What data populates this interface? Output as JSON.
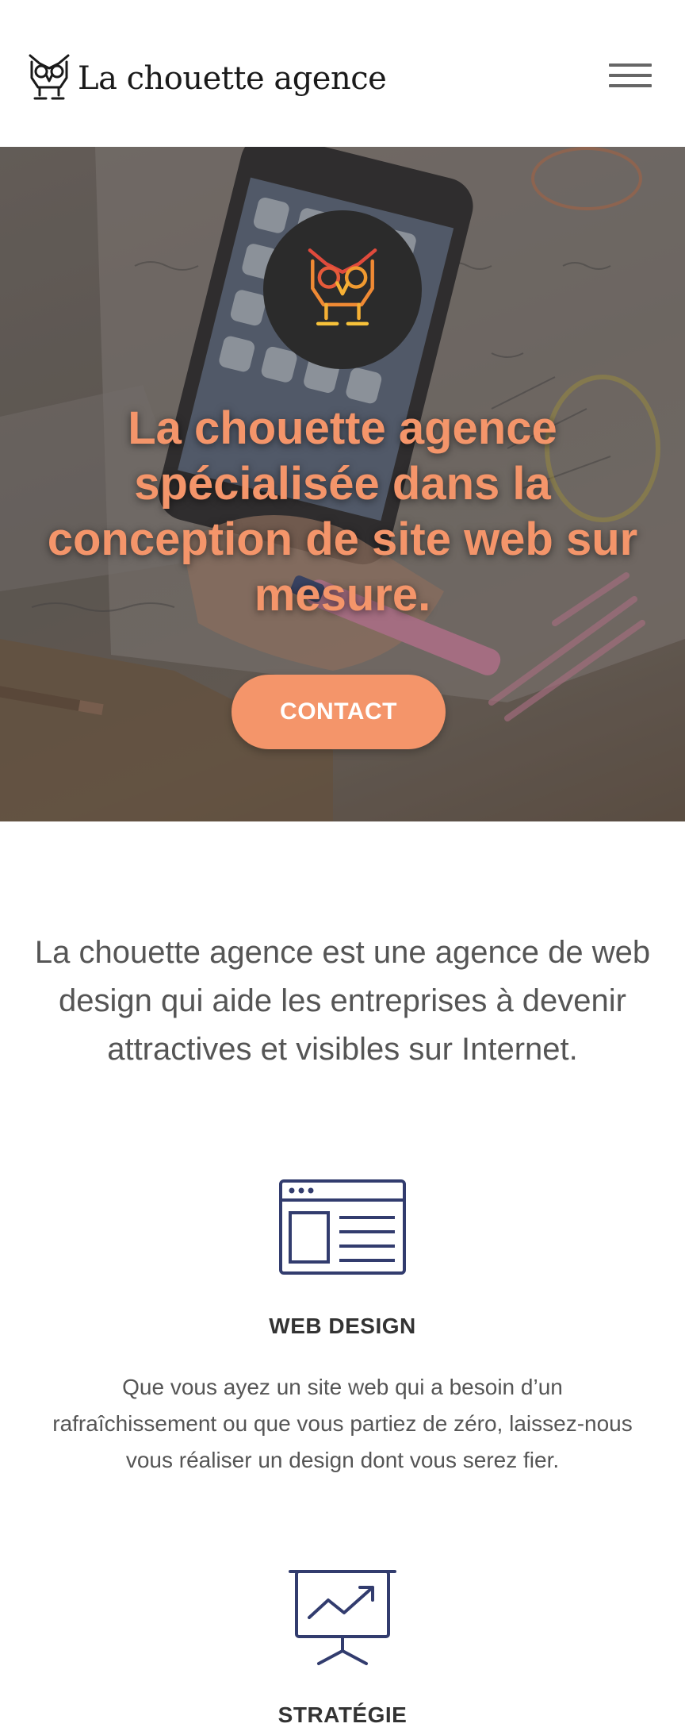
{
  "header": {
    "brand_name": "La chouette agence",
    "logo_icon": "owl-icon",
    "menu_icon": "hamburger-menu-icon"
  },
  "hero": {
    "title": "La chouette agence spécialisée dans la conception de site web sur mesure.",
    "contact_label": "CONTACT",
    "logo_icon": "owl-icon",
    "accent_color": "#f4956a"
  },
  "intro": {
    "text": "La chouette agence est une agence de web design qui aide les entreprises à devenir attractives et visibles sur Internet."
  },
  "services": [
    {
      "icon": "web-design-icon",
      "title": "WEB DESIGN",
      "description": "Que vous ayez un site web qui a besoin d’un rafraîchissement ou que vous partiez de zéro, laissez-nous vous réaliser un design dont vous serez fier."
    },
    {
      "icon": "strategy-presentation-icon",
      "title": "STRATÉGIE",
      "description": ""
    }
  ],
  "colors": {
    "accent": "#f4956a",
    "icon_navy": "#323c6e",
    "text": "#555555"
  }
}
